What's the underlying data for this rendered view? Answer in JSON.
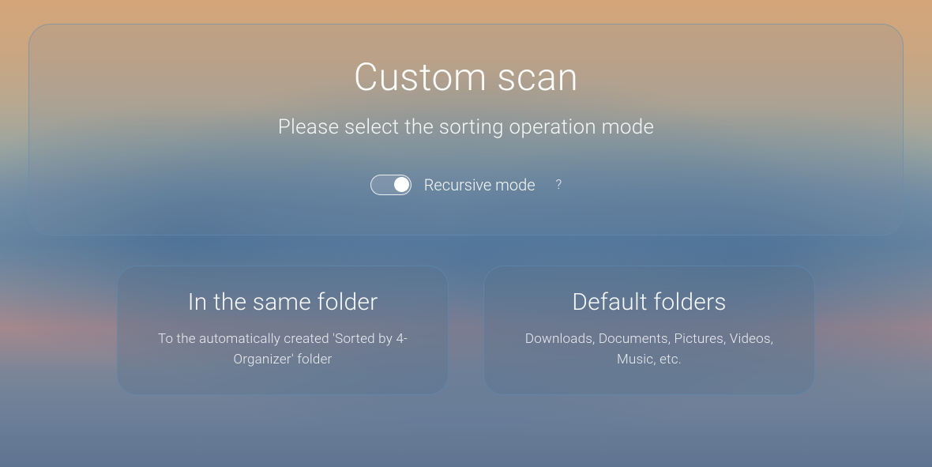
{
  "header": {
    "title": "Custom scan",
    "subtitle": "Please select the sorting operation mode"
  },
  "toggle": {
    "label": "Recursive mode",
    "help": "?"
  },
  "options": [
    {
      "title": "In the same folder",
      "description": "To the automatically created 'Sorted by 4-Organizer' folder"
    },
    {
      "title": "Default folders",
      "description": "Downloads, Documents, Pictures, Videos, Music, etc."
    }
  ]
}
